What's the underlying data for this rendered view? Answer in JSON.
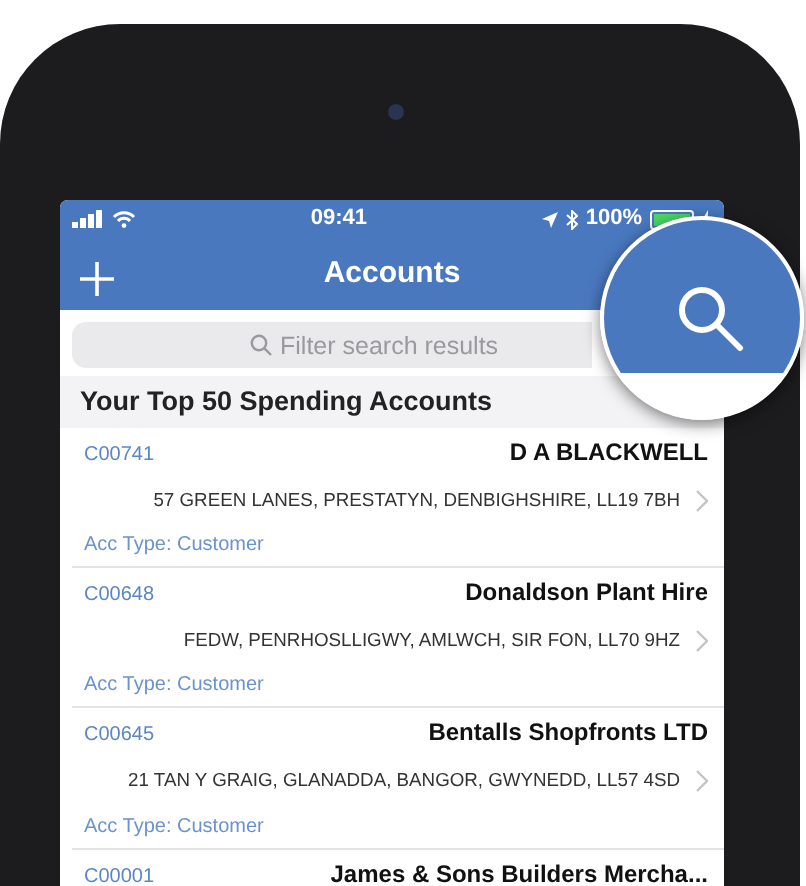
{
  "status_bar": {
    "time": "09:41",
    "battery": "100%"
  },
  "nav": {
    "title": "Accounts"
  },
  "search": {
    "placeholder": "Filter search results"
  },
  "section_title": "Your Top 50 Spending Accounts",
  "accounts": [
    {
      "code": "C00741",
      "name": "D A BLACKWELL",
      "address": "57 GREEN LANES, PRESTATYN, DENBIGHSHIRE, LL19 7BH",
      "acc_type": "Acc Type: Customer"
    },
    {
      "code": "C00648",
      "name": "Donaldson Plant Hire",
      "address": "FEDW, PENRHOSLLIGWY, AMLWCH, SIR FON, LL70 9HZ",
      "acc_type": "Acc Type: Customer"
    },
    {
      "code": "C00645",
      "name": "Bentalls Shopfronts LTD",
      "address": "21 TAN Y GRAIG, GLANADDA, BANGOR, GWYNEDD, LL57 4SD",
      "acc_type": "Acc Type: Customer"
    },
    {
      "code": "C00001",
      "name": "James & Sons Builders Mercha..."
    }
  ]
}
